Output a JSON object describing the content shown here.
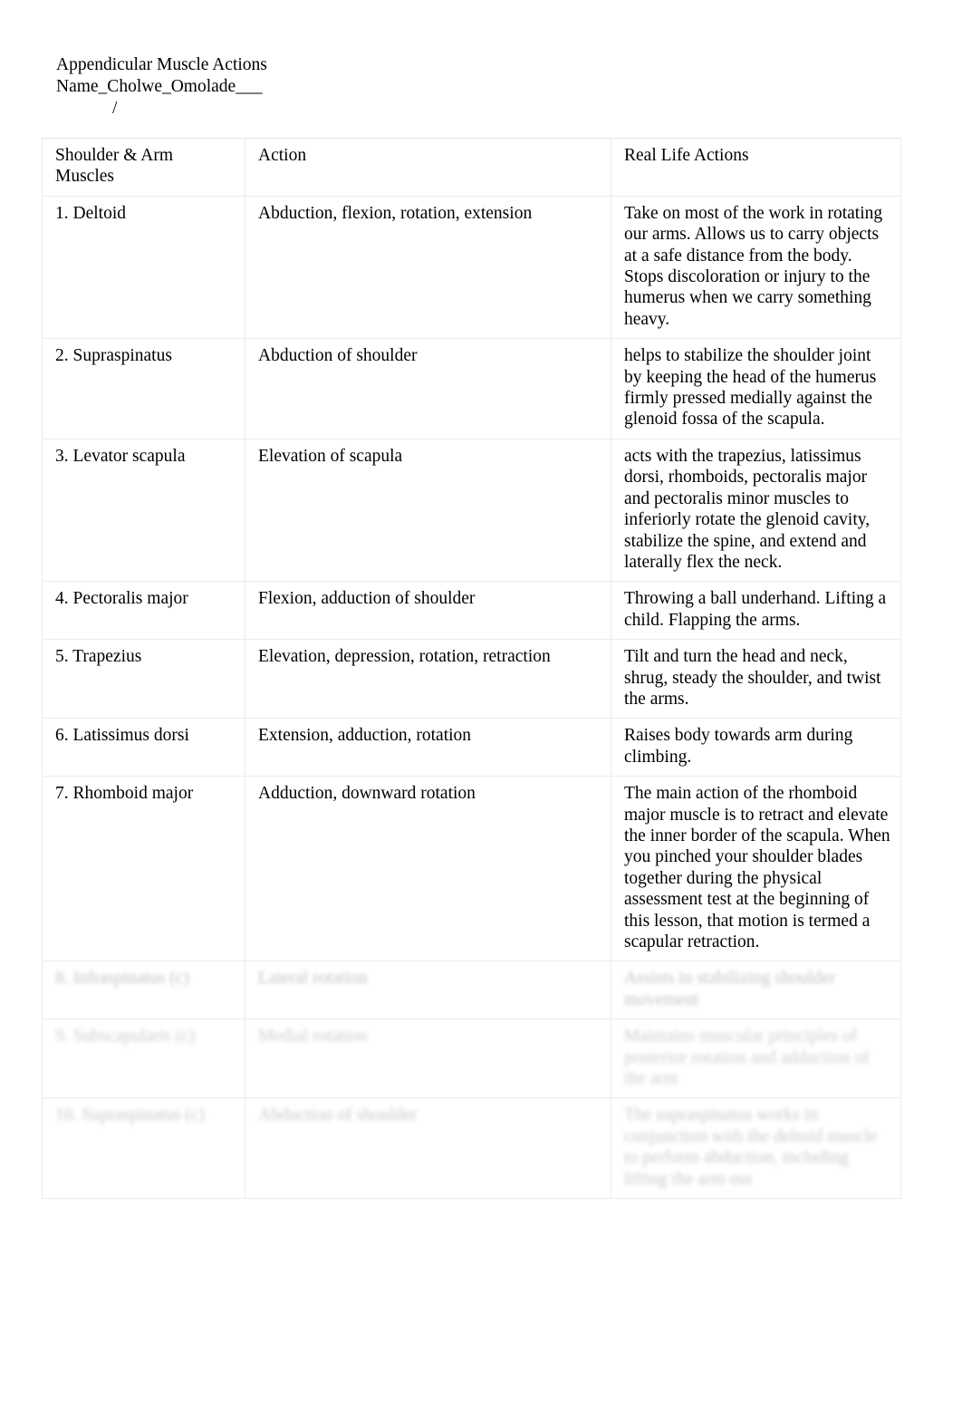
{
  "document": {
    "title": "Appendicular Muscle Actions",
    "name_line": "Name_Cholwe_Omolade___",
    "slash_mark": "/"
  },
  "table": {
    "headers": {
      "muscle": "Shoulder & Arm Muscles",
      "action": "Action",
      "real_life": "Real Life Actions"
    },
    "rows": [
      {
        "muscle": "1. Deltoid",
        "action": "Abduction, flexion, rotation, extension",
        "real_life": "Take on most of the work in rotating our arms. Allows us to carry objects at a safe distance from the body. Stops discoloration or injury to the humerus when we carry something heavy."
      },
      {
        "muscle": "2. Supraspinatus",
        "action": "Abduction of shoulder",
        "real_life": "helps to stabilize the shoulder joint by keeping the head of the humerus firmly pressed medially against the glenoid fossa of the scapula."
      },
      {
        "muscle": "3. Levator scapula",
        "action": "Elevation of scapula",
        "real_life": "acts with the trapezius, latissimus dorsi, rhomboids, pectoralis major and pectoralis minor muscles to inferiorly rotate the glenoid cavity, stabilize the spine, and extend and laterally flex the neck."
      },
      {
        "muscle": "4. Pectoralis major",
        "action": "Flexion, adduction of shoulder",
        "real_life": "Throwing a ball underhand. Lifting a child. Flapping the arms."
      },
      {
        "muscle": "5. Trapezius",
        "action": "Elevation, depression, rotation, retraction",
        "real_life": "Tilt and turn the head and neck, shrug, steady the shoulder, and twist the arms."
      },
      {
        "muscle": "6. Latissimus dorsi",
        "action": "Extension, adduction, rotation",
        "real_life": "Raises body towards arm during climbing."
      },
      {
        "muscle": "7. Rhomboid major",
        "action": "Adduction, downward rotation",
        "real_life": "The main action of the rhomboid major muscle is to retract and elevate the inner border of the scapula. When you pinched your shoulder blades together during the physical assessment test at the beginning of this lesson, that motion is termed a scapular retraction."
      },
      {
        "muscle": "8. Infraspinatus (c)",
        "action": "Lateral rotation",
        "real_life": "Assists in stabilizing shoulder movement"
      },
      {
        "muscle": "9. Subscapularis (c)",
        "action": "Medial rotation",
        "real_life": "Maintains muscular principles of posterior rotation and adduction of the arm"
      },
      {
        "muscle": "10. Supraspinatus (c)",
        "action": "Abduction of shoulder",
        "real_life": "The supraspinatus works in conjunction with the deltoid muscle to perform abduction, including lifting the arm out"
      }
    ]
  }
}
